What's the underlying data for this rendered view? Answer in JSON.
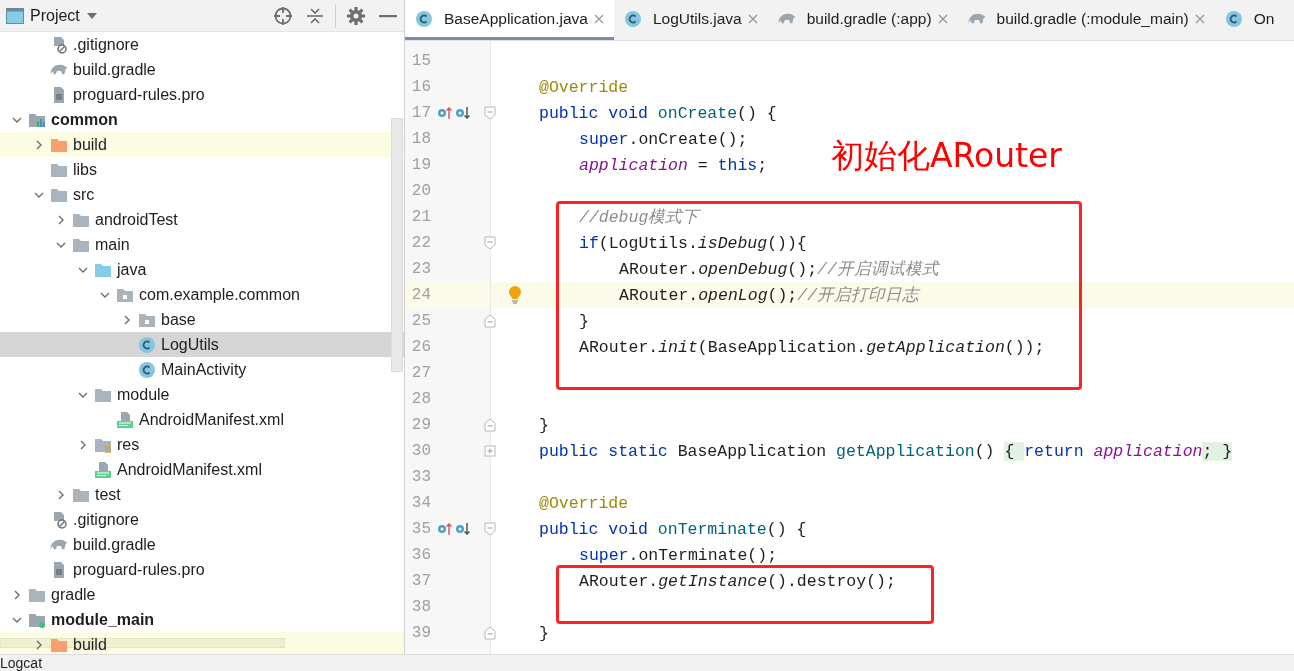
{
  "project_panel": {
    "title": "Project",
    "tree": [
      {
        "children": [
          {
            "label": ".gitignore",
            "kind": "git",
            "selected": false,
            "highlighted": false
          },
          {
            "label": "build.gradle",
            "kind": "gradle",
            "selected": false,
            "highlighted": false
          },
          {
            "label": "proguard-rules.pro",
            "kind": "file",
            "selected": false,
            "highlighted": false
          }
        ]
      },
      {
        "label": "common",
        "kind": "module",
        "bold": true,
        "expanded": true,
        "selected": false,
        "highlighted": false,
        "children": [
          {
            "label": "build",
            "kind": "folder-excluded",
            "expanded": false,
            "selected": false,
            "highlighted": true
          },
          {
            "label": "libs",
            "kind": "folder",
            "selected": false,
            "highlighted": false
          },
          {
            "label": "src",
            "kind": "folder",
            "expanded": true,
            "selected": false,
            "highlighted": false,
            "children": [
              {
                "label": "androidTest",
                "kind": "folder",
                "expanded": false,
                "selected": false,
                "highlighted": false
              },
              {
                "label": "main",
                "kind": "folder",
                "expanded": true,
                "selected": false,
                "highlighted": false,
                "children": [
                  {
                    "label": "java",
                    "kind": "folder-source",
                    "expanded": true,
                    "selected": false,
                    "highlighted": false,
                    "children": [
                      {
                        "label": "com.example.common",
                        "kind": "package",
                        "expanded": true,
                        "selected": false,
                        "highlighted": false,
                        "children": [
                          {
                            "label": "base",
                            "kind": "package",
                            "expanded": false,
                            "selected": false,
                            "highlighted": false
                          },
                          {
                            "label": "LogUtils",
                            "kind": "class",
                            "selected": true,
                            "highlighted": false
                          },
                          {
                            "label": "MainActivity",
                            "kind": "class",
                            "selected": false,
                            "highlighted": false
                          }
                        ]
                      }
                    ]
                  },
                  {
                    "label": "module",
                    "kind": "folder",
                    "expanded": true,
                    "selected": false,
                    "highlighted": false,
                    "children": [
                      {
                        "label": "AndroidManifest.xml",
                        "kind": "manifest",
                        "selected": false,
                        "highlighted": false
                      }
                    ]
                  },
                  {
                    "label": "res",
                    "kind": "folder-res",
                    "expanded": false,
                    "selected": false,
                    "highlighted": false
                  },
                  {
                    "label": "AndroidManifest.xml",
                    "kind": "manifest",
                    "selected": false,
                    "highlighted": false
                  }
                ]
              },
              {
                "label": "test",
                "kind": "folder",
                "expanded": false,
                "selected": false,
                "highlighted": false
              }
            ]
          },
          {
            "label": ".gitignore",
            "kind": "git",
            "selected": false,
            "highlighted": false
          },
          {
            "label": "build.gradle",
            "kind": "gradle",
            "selected": false,
            "highlighted": false
          },
          {
            "label": "proguard-rules.pro",
            "kind": "file",
            "selected": false,
            "highlighted": false
          }
        ]
      },
      {
        "label": "gradle",
        "kind": "folder",
        "expanded": false,
        "selected": false,
        "highlighted": false
      },
      {
        "label": "module_main",
        "kind": "module-app",
        "bold": true,
        "expanded": true,
        "selected": false,
        "highlighted": false,
        "children": [
          {
            "label": "build",
            "kind": "folder-excluded",
            "expanded": false,
            "selected": false,
            "highlighted": true
          }
        ]
      }
    ]
  },
  "tabs": [
    {
      "label": "BaseApplication.java",
      "kind": "class",
      "selected": true,
      "closable": true
    },
    {
      "label": "LogUtils.java",
      "kind": "class",
      "selected": false,
      "closable": true
    },
    {
      "label": "build.gradle (:app)",
      "kind": "gradle",
      "selected": false,
      "closable": true
    },
    {
      "label": "build.gradle (:module_main)",
      "kind": "gradle",
      "selected": false,
      "closable": true
    },
    {
      "label": "On",
      "kind": "class",
      "selected": false,
      "closable": false
    }
  ],
  "editor": {
    "annotation": "初始化ARouter",
    "lines": [
      {
        "number": "15"
      },
      {
        "number": "16",
        "tokens": [
          {
            "text": "@Override",
            "kind": "ann"
          }
        ]
      },
      {
        "number": "17",
        "gutter_marks": [
          {
            "kind": "override"
          },
          {
            "kind": "fold-start"
          }
        ],
        "tokens": [
          {
            "text": "public void",
            "kind": "kw"
          },
          {
            "text": " onCreate",
            "kind": "fn"
          },
          {
            "text": "() {",
            "kind": "plain"
          }
        ],
        "children": [
          {
            "number": "18",
            "tokens": [
              {
                "text": "super",
                "kind": "kw"
              },
              {
                "text": ".onCreate();",
                "kind": "plain"
              }
            ]
          },
          {
            "number": "19",
            "tokens": [
              {
                "text": "application",
                "kind": "field"
              },
              {
                "text": " = ",
                "kind": "plain"
              },
              {
                "text": "this",
                "kind": "kw"
              },
              {
                "text": ";",
                "kind": "plain"
              }
            ]
          },
          {
            "number": "20"
          },
          {
            "number": "21",
            "boxed": true,
            "tokens": [
              {
                "text": "//debug模式下",
                "kind": "comment"
              }
            ]
          },
          {
            "number": "22",
            "boxed": true,
            "gutter_marks": [
              {
                "kind": "fold-start"
              }
            ],
            "tokens": [
              {
                "text": "if",
                "kind": "kw"
              },
              {
                "text": "(LogUtils.",
                "kind": "plain"
              },
              {
                "text": "isDebug",
                "kind": "call"
              },
              {
                "text": "()){",
                "kind": "plain"
              }
            ],
            "children": [
              {
                "number": "23",
                "tokens": [
                  {
                    "text": "ARouter.",
                    "kind": "plain"
                  },
                  {
                    "text": "openDebug",
                    "kind": "call"
                  },
                  {
                    "text": "();",
                    "kind": "plain"
                  },
                  {
                    "text": "//开启调试模式",
                    "kind": "comment"
                  }
                ]
              },
              {
                "number": "24",
                "current": true,
                "gutter_marks": [
                  {
                    "kind": "bulb"
                  }
                ],
                "tokens": [
                  {
                    "text": "ARouter.",
                    "kind": "plain"
                  },
                  {
                    "text": "openLog",
                    "kind": "call"
                  },
                  {
                    "text": "();",
                    "kind": "plain"
                  },
                  {
                    "text": "//开启打印日志",
                    "kind": "comment"
                  }
                ]
              }
            ]
          },
          {
            "number": "25",
            "boxed": true,
            "gutter_marks": [
              {
                "kind": "fold-end"
              }
            ],
            "tokens": [
              {
                "text": "}",
                "kind": "plain"
              }
            ]
          },
          {
            "number": "26",
            "boxed": true,
            "tokens": [
              {
                "text": "ARouter.",
                "kind": "plain"
              },
              {
                "text": "init",
                "kind": "call"
              },
              {
                "text": "(BaseApplication.",
                "kind": "plain"
              },
              {
                "text": "getApplication",
                "kind": "call"
              },
              {
                "text": "());",
                "kind": "plain"
              }
            ]
          },
          {
            "number": "27",
            "boxed": true
          },
          {
            "number": "28"
          }
        ]
      },
      {
        "number": "29",
        "gutter_marks": [
          {
            "kind": "fold-end"
          }
        ],
        "tokens": [
          {
            "text": "}",
            "kind": "plain"
          }
        ]
      },
      {
        "number": "30",
        "gutter_marks": [
          {
            "kind": "fold-collapsed"
          }
        ],
        "tokens": [
          {
            "text": "public static",
            "kind": "kw"
          },
          {
            "text": " BaseApplication ",
            "kind": "plain"
          },
          {
            "text": "getApplication",
            "kind": "fn"
          },
          {
            "text": "() ",
            "kind": "plain"
          },
          {
            "text": "{ ",
            "kind": "folded"
          },
          {
            "text": "return",
            "kind": "kw"
          },
          {
            "text": " application",
            "kind": "field"
          },
          {
            "text": "; }",
            "kind": "folded"
          }
        ]
      },
      {
        "number": "33"
      },
      {
        "number": "34",
        "tokens": [
          {
            "text": "@Override",
            "kind": "ann"
          }
        ]
      },
      {
        "number": "35",
        "gutter_marks": [
          {
            "kind": "override"
          },
          {
            "kind": "fold-start"
          }
        ],
        "tokens": [
          {
            "text": "public void",
            "kind": "kw"
          },
          {
            "text": " onTerminate",
            "kind": "fn"
          },
          {
            "text": "() {",
            "kind": "plain"
          }
        ],
        "children": [
          {
            "number": "36",
            "tokens": [
              {
                "text": "super",
                "kind": "kw"
              },
              {
                "text": ".onTerminate();",
                "kind": "plain"
              }
            ]
          },
          {
            "number": "37",
            "boxed": true,
            "tokens": [
              {
                "text": "ARouter.",
                "kind": "plain"
              },
              {
                "text": "getInstance",
                "kind": "call"
              },
              {
                "text": "().destroy();",
                "kind": "plain"
              }
            ]
          },
          {
            "number": "38",
            "boxed": true
          }
        ]
      },
      {
        "number": "39",
        "gutter_marks": [
          {
            "kind": "fold-end"
          }
        ],
        "tokens": [
          {
            "text": "}",
            "kind": "plain"
          }
        ]
      }
    ]
  },
  "bottom_bar": {
    "tool_window": "Logcat"
  }
}
